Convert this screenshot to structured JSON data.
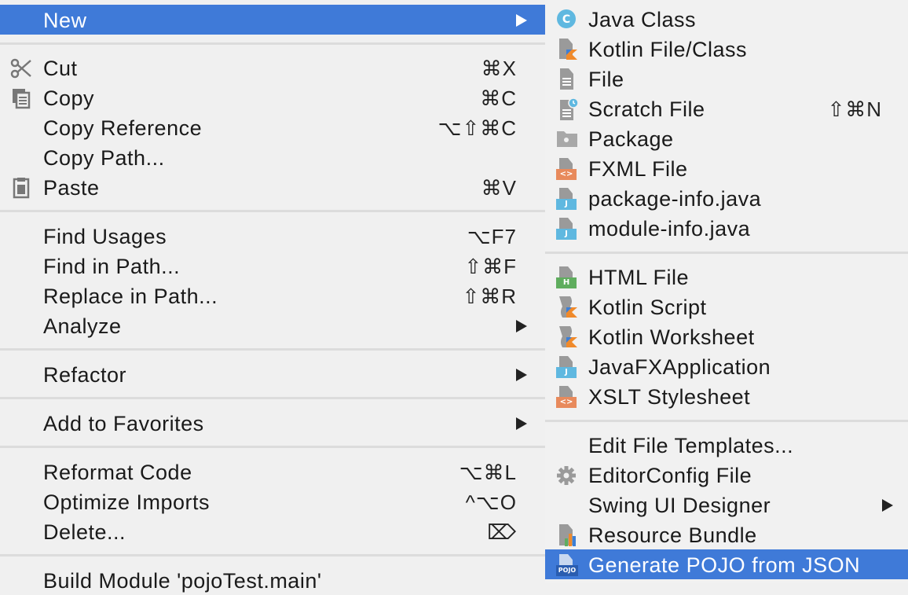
{
  "main_menu": {
    "items": [
      {
        "label": "New",
        "shortcut": "",
        "has_submenu": true
      },
      {
        "label": "Cut",
        "shortcut": "⌘X",
        "icon": "scissors-icon"
      },
      {
        "label": "Copy",
        "shortcut": "⌘C",
        "icon": "copy-icon"
      },
      {
        "label": "Copy Reference",
        "shortcut": "⌥⇧⌘C"
      },
      {
        "label": "Copy Path...",
        "shortcut": ""
      },
      {
        "label": "Paste",
        "shortcut": "⌘V",
        "icon": "clipboard-icon"
      },
      {
        "label": "Find Usages",
        "shortcut": "⌥F7"
      },
      {
        "label": "Find in Path...",
        "shortcut": "⇧⌘F"
      },
      {
        "label": "Replace in Path...",
        "shortcut": "⇧⌘R"
      },
      {
        "label": "Analyze",
        "has_submenu": true
      },
      {
        "label": "Refactor",
        "has_submenu": true
      },
      {
        "label": "Add to Favorites",
        "has_submenu": true
      },
      {
        "label": "Reformat Code",
        "shortcut": "⌥⌘L"
      },
      {
        "label": "Optimize Imports",
        "shortcut": "^⌥O"
      },
      {
        "label": "Delete...",
        "shortcut": "⌦"
      },
      {
        "label": "Build Module 'pojoTest.main'",
        "shortcut": ""
      }
    ]
  },
  "sub_menu": {
    "items": [
      {
        "label": "Java Class",
        "icon": "java-class-icon",
        "icon_letter": "C"
      },
      {
        "label": "Kotlin File/Class",
        "icon": "kotlin-file-icon"
      },
      {
        "label": "File",
        "icon": "file-icon"
      },
      {
        "label": "Scratch File",
        "shortcut": "⇧⌘N",
        "icon": "scratch-file-icon"
      },
      {
        "label": "Package",
        "icon": "package-folder-icon"
      },
      {
        "label": "FXML File",
        "icon": "fxml-file-icon",
        "tag": "<>"
      },
      {
        "label": "package-info.java",
        "icon": "java-file-icon",
        "tag": "J"
      },
      {
        "label": "module-info.java",
        "icon": "java-file-icon",
        "tag": "J"
      },
      {
        "label": "HTML File",
        "icon": "html-file-icon",
        "tag": "H"
      },
      {
        "label": "Kotlin Script",
        "icon": "kotlin-script-icon"
      },
      {
        "label": "Kotlin Worksheet",
        "icon": "kotlin-worksheet-icon"
      },
      {
        "label": "JavaFXApplication",
        "icon": "java-file-icon",
        "tag": "J"
      },
      {
        "label": "XSLT Stylesheet",
        "icon": "xslt-file-icon",
        "tag": "<>"
      },
      {
        "label": "Edit File Templates..."
      },
      {
        "label": "EditorConfig File",
        "icon": "gear-icon"
      },
      {
        "label": "Swing UI Designer",
        "has_submenu": true
      },
      {
        "label": "Resource Bundle",
        "icon": "resource-bundle-icon"
      },
      {
        "label": "Generate POJO from JSON",
        "icon": "pojo-icon",
        "tag": "POJO"
      }
    ]
  },
  "colors": {
    "selection": "#3f7ad8",
    "menu_bg": "#f0f0f0",
    "separator": "#dcdcdc",
    "java_blue": "#5fb8e0",
    "xml_orange": "#e88a5c",
    "html_green": "#5fad5e",
    "kotlin_orange": "#f08a2b",
    "kotlin_blue": "#3c7fd6"
  }
}
